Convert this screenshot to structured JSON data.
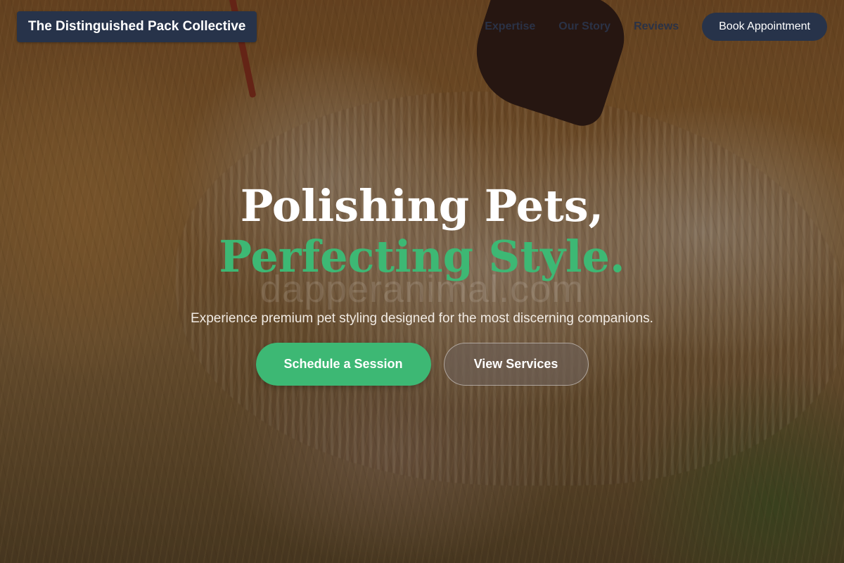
{
  "header": {
    "brand": "The Distinguished Pack Collective",
    "nav": [
      {
        "label": "Expertise"
      },
      {
        "label": "Our Story"
      },
      {
        "label": "Reviews"
      }
    ],
    "cta_label": "Book Appointment"
  },
  "hero": {
    "headline_line1": "Polishing Pets,",
    "headline_line2": "Perfecting Style.",
    "watermark": "dapperanimal.com",
    "subtitle": "Experience premium pet styling designed for the most discerning companions.",
    "primary_button": "Schedule a Session",
    "secondary_button": "View Services"
  },
  "colors": {
    "navy": "#27334a",
    "accent_green": "#3db874",
    "white": "#ffffff"
  }
}
